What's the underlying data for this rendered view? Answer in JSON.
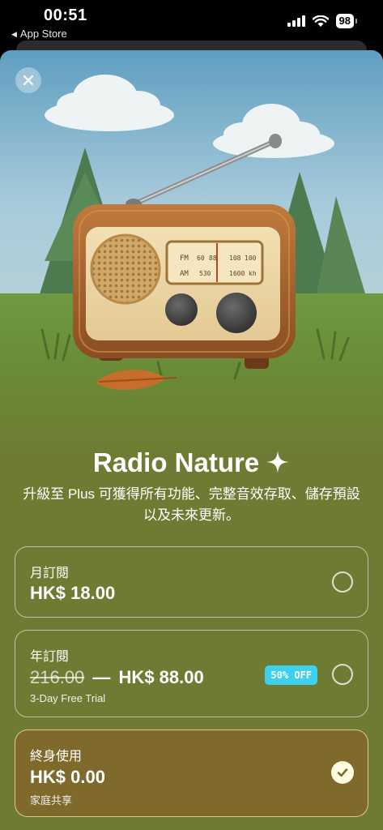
{
  "status_bar": {
    "time": "00:51",
    "back_app": "App Store",
    "battery": "98"
  },
  "paywall": {
    "title": "Radio Nature",
    "subtitle": "升級至 Plus 可獲得所有功能、完整音效存取、儲存預設以及未來更新。",
    "radio_dial": {
      "fm_band": "FM",
      "fm_marks": [
        "60",
        "88",
        "108",
        "100"
      ],
      "am_band": "AM",
      "am_marks": [
        "530",
        "1600",
        "kh"
      ]
    },
    "plans": [
      {
        "label": "月訂閱",
        "price": "HK$ 18.00",
        "selected": false
      },
      {
        "label": "年訂閱",
        "old_price": "216.00",
        "separator": "—",
        "price": "HK$ 88.00",
        "badge": "50% OFF",
        "note": "3-Day Free Trial",
        "selected": false
      },
      {
        "label": "終身使用",
        "price": "HK$ 0.00",
        "note": "家庭共享",
        "selected": true
      }
    ]
  },
  "colors": {
    "background": "#6e7c33",
    "selected_plan": "#7f6a2b",
    "badge": "#3fd0ee",
    "check": "#fffbe0"
  }
}
